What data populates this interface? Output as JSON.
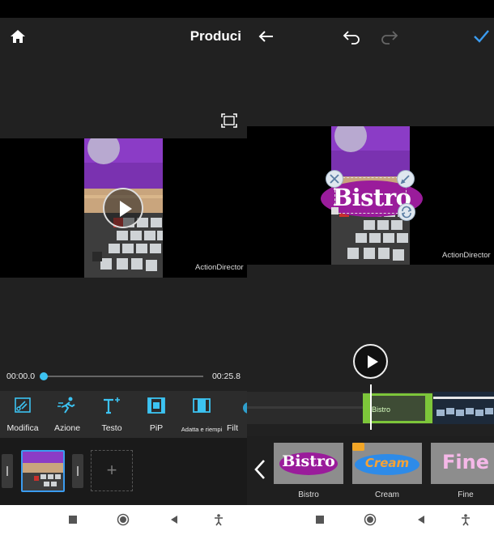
{
  "left": {
    "produce_label": "Produci",
    "watermark": "ActionDirector",
    "time_start": "00:00.0",
    "time_end": "00:25.8",
    "playback_progress": 0.0,
    "tools": [
      {
        "label": "Modifica",
        "icon": "edit-scissors-icon"
      },
      {
        "label": "Azione",
        "icon": "running-man-icon"
      },
      {
        "label": "Testo",
        "icon": "text-icon"
      },
      {
        "label": "PiP",
        "icon": "film-icon"
      },
      {
        "label": "Adatta e riempi",
        "icon": "fit-fill-icon"
      },
      {
        "label": "Filt",
        "icon": "filter-icon"
      }
    ],
    "add_clip": "+"
  },
  "right": {
    "title_text": "Bistro",
    "watermark": "ActionDirector",
    "timeline_clip_label": "Bistro",
    "templates": [
      {
        "name": "Bistro",
        "preview": "Bistro",
        "premium": false
      },
      {
        "name": "Cream",
        "preview": "Cream",
        "premium": true
      },
      {
        "name": "Fine",
        "preview": "Fine",
        "premium": false
      }
    ]
  },
  "colors": {
    "accent": "#3cc3f2",
    "title_purple": "#9a1c9b",
    "timeline_green": "#7dc63a",
    "check_blue": "#3b9cf0"
  }
}
